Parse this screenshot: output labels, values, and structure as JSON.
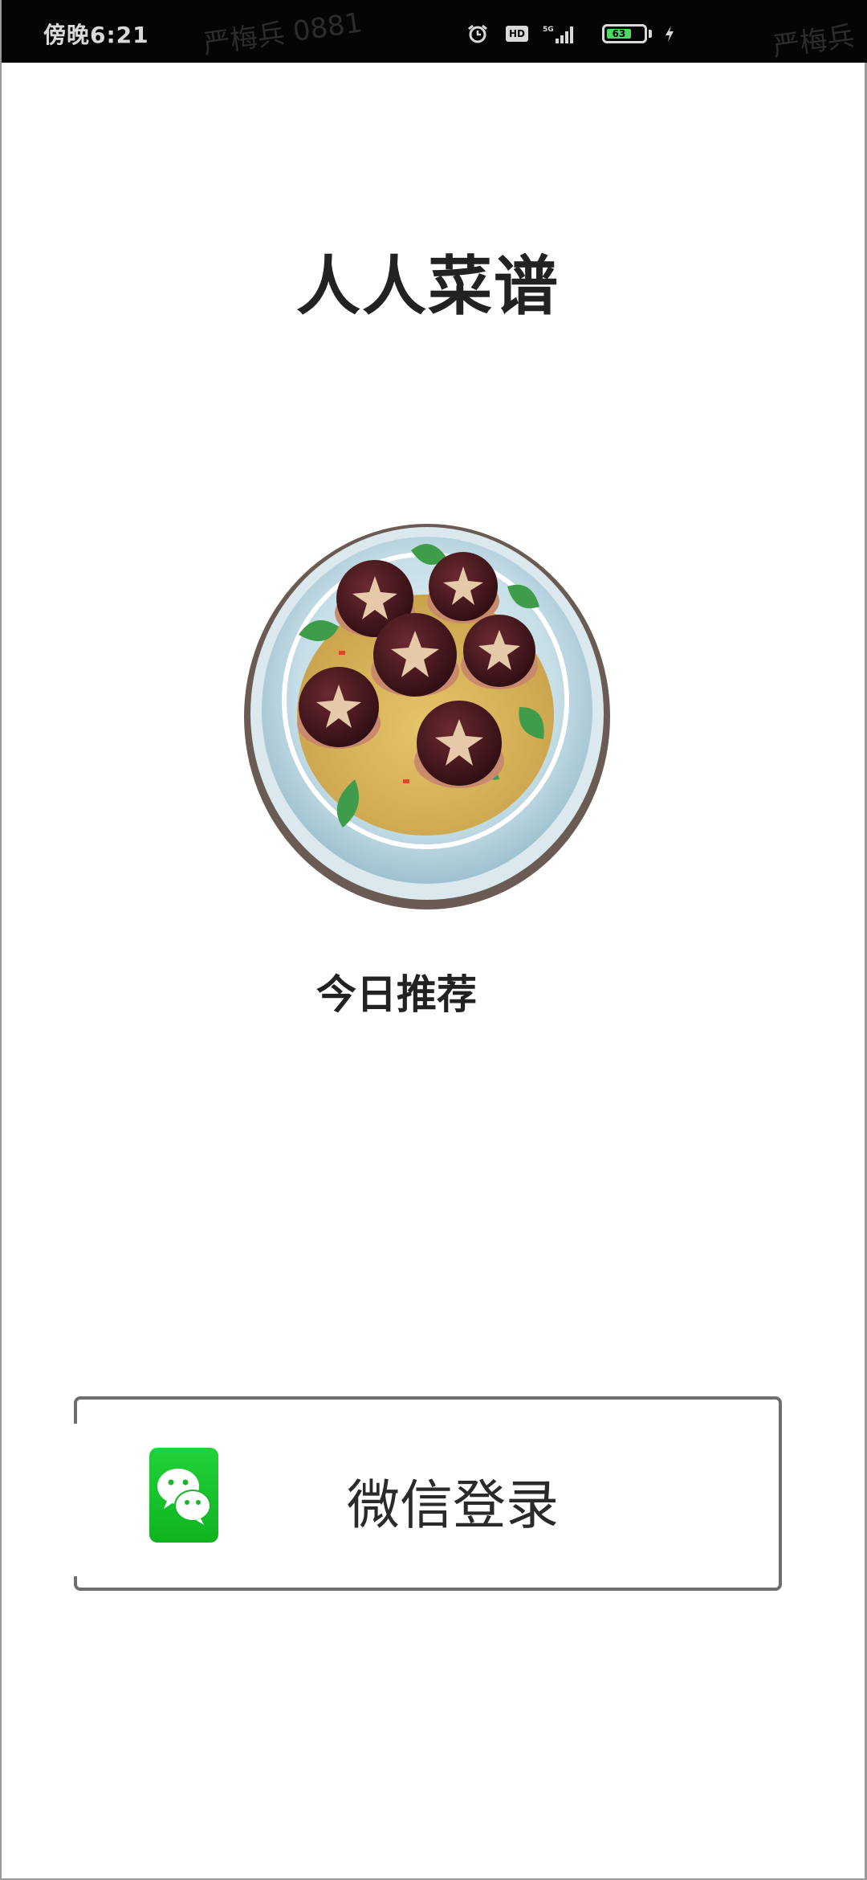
{
  "status_bar": {
    "time": "傍晚6:21",
    "watermark": "严梅兵 0881",
    "watermark_right": "严梅兵",
    "hd_label": "HD",
    "battery_level": "63",
    "icons": [
      "alarm-icon",
      "hd-icon",
      "signal-5g-icon",
      "battery-icon",
      "charging-icon"
    ]
  },
  "app": {
    "title": "人人菜谱",
    "recommend_label": "今日推荐",
    "dish_image_alt": "shiitake-mushroom-dish",
    "login_button_label": "微信登录",
    "login_icon": "wechat-icon"
  },
  "colors": {
    "wechat_green": "#1ec531",
    "status_bar_bg": "#050505",
    "text_dark": "#222222",
    "button_border": "#6e6e6e"
  }
}
